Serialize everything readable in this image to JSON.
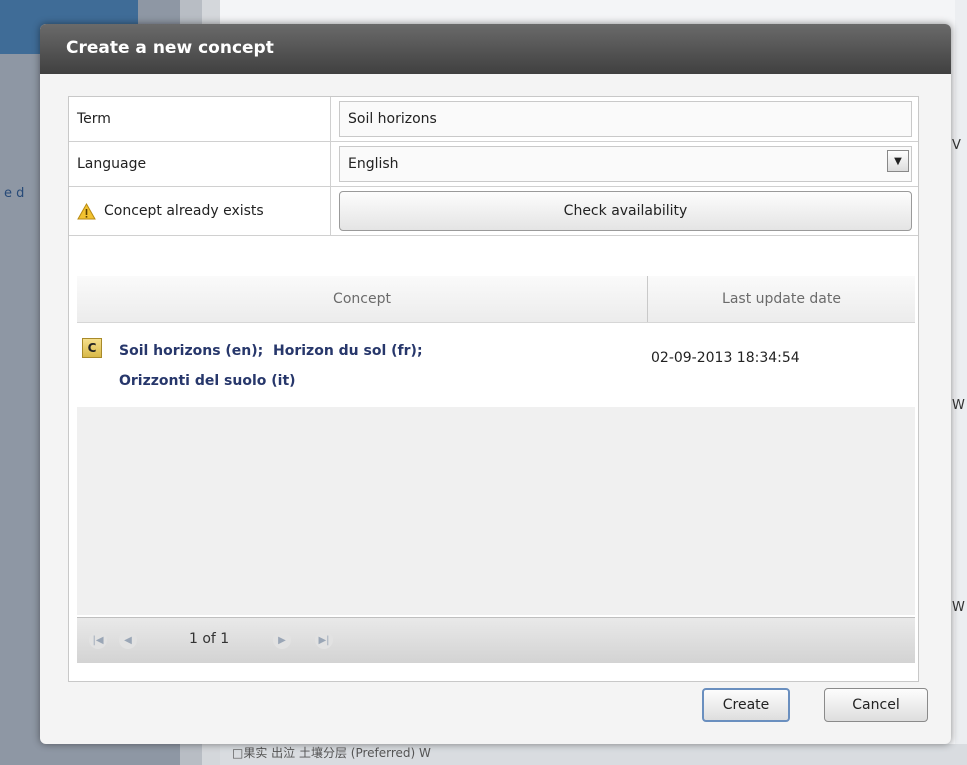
{
  "background": {
    "side_text": "e d",
    "right_letters": [
      "V",
      "W",
      "W"
    ],
    "bottom_text": "□果实 出泣   土壤分层 (Preferred) W"
  },
  "dialog": {
    "title": "Create a new concept",
    "term_label": "Term",
    "term_value": "Soil horizons",
    "language_label": "Language",
    "language_value": "English",
    "status_label": "Concept already exists",
    "check_button_label": "Check availability",
    "table": {
      "headers": [
        "Concept",
        "Last update date"
      ],
      "rows": [
        {
          "badge": "C",
          "concepts": [
            "Soil horizons (en);",
            "Horizon du sol (fr);",
            "Orizzonti del suolo (it)"
          ],
          "last_update": "02-09-2013 18:34:54"
        }
      ]
    },
    "pager": {
      "info": "1 of 1",
      "first_icon": "first-page-icon",
      "prev_icon": "prev-page-icon",
      "next_icon": "next-page-icon",
      "last_icon": "last-page-icon"
    },
    "create_label": "Create",
    "cancel_label": "Cancel"
  },
  "colors": {
    "header_dark": "#404040",
    "link_blue": "#27376b",
    "warning_yellow": "#f2c230",
    "badge_gold": "#d8b948"
  }
}
